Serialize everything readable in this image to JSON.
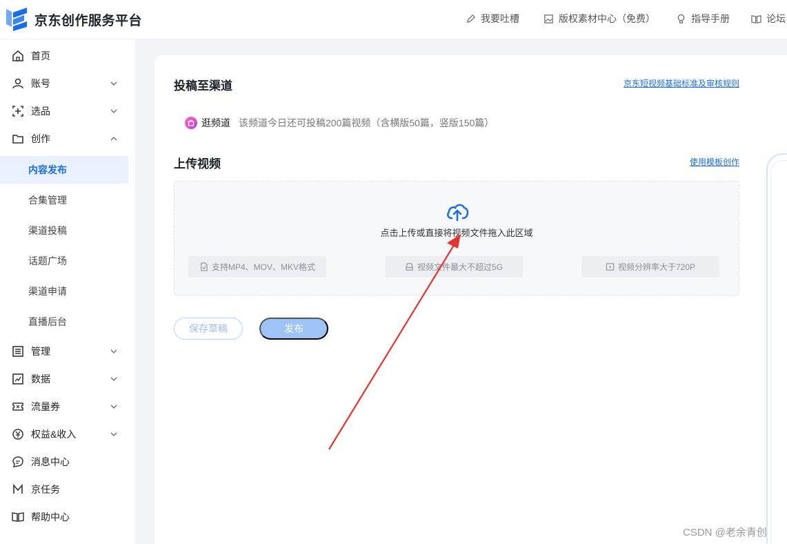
{
  "header": {
    "brand": "京东创作服务平台",
    "nav": [
      {
        "label": "我要吐槽",
        "icon": "pencil-icon"
      },
      {
        "label": "版权素材中心（免费）",
        "icon": "image-icon"
      },
      {
        "label": "指导手册",
        "icon": "lightbulb-icon"
      },
      {
        "label": "论坛",
        "icon": "book-icon"
      }
    ]
  },
  "sidebar": {
    "items": [
      {
        "label": "首页",
        "icon": "home-icon"
      },
      {
        "label": "账号",
        "icon": "user-icon"
      },
      {
        "label": "选品",
        "icon": "select-icon"
      },
      {
        "label": "创作",
        "icon": "folder-icon"
      },
      {
        "label": "管理",
        "icon": "list-icon"
      },
      {
        "label": "数据",
        "icon": "chart-icon"
      },
      {
        "label": "流量券",
        "icon": "ticket-icon"
      },
      {
        "label": "权益&收入",
        "icon": "yuan-icon"
      },
      {
        "label": "消息中心",
        "icon": "message-icon"
      },
      {
        "label": "京任务",
        "icon": "task-icon"
      },
      {
        "label": "帮助中心",
        "icon": "help-book-icon"
      }
    ],
    "sub_items": [
      "内容发布",
      "合集管理",
      "渠道投稿",
      "话题广场",
      "渠道申请",
      "直播后台"
    ]
  },
  "main": {
    "section_channel": "投稿至渠道",
    "rules_link": "京东短视频基础标准及审核规则",
    "channel_name": "逛频道",
    "channel_desc": "该频道今日还可投稿200篇视频（含横版50篇，竖版150篇）",
    "section_upload": "上传视频",
    "template_link": "使用模板创作",
    "upload_text": "点击上传或直接将视频文件拖入此区域",
    "chips": [
      "支持MP4、MOV、MKV格式",
      "视频文件最大不超过5G",
      "视频分辨率大于720P"
    ],
    "save_draft": "保存草稿",
    "publish": "发布"
  },
  "watermark": "CSDN @老余青创",
  "colors": {
    "accent": "#1a6ee9",
    "annotation": "#e8322e"
  }
}
